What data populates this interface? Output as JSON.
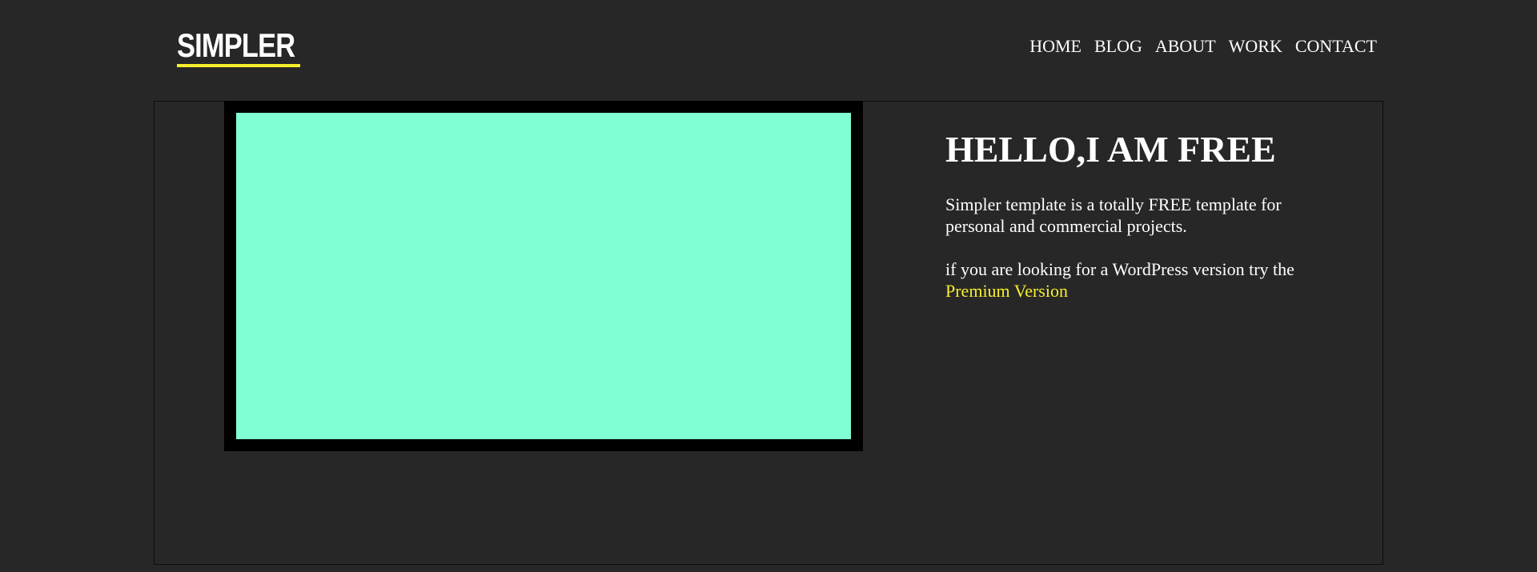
{
  "brand": {
    "logo_text": "SIMPLER",
    "accent_color": "#f5ef2b"
  },
  "nav": {
    "items": [
      "HOME",
      "BLOG",
      "ABOUT",
      "WORK",
      "CONTACT"
    ]
  },
  "media": {
    "frame_color": "#000000",
    "fill_color": "#80ffd5"
  },
  "hero": {
    "title": "HELLO,I AM FREE",
    "paragraph1": "Simpler template is a totally FREE template for personal and commercial projects.",
    "paragraph2_prefix": "if you are looking for a WordPress version try the ",
    "premium_link": "Premium Version"
  }
}
